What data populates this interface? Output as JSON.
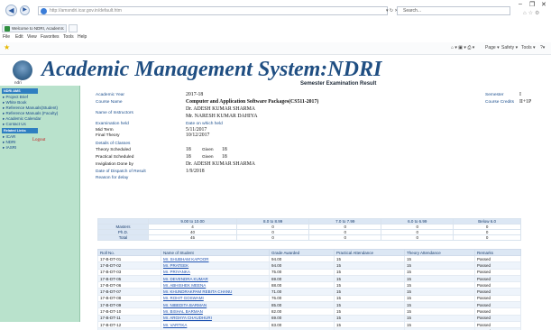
{
  "browser": {
    "address": "http://amsndri.icar.gov.in/default.htm",
    "search_placeholder": "Search...",
    "tab_title": "Welcome to NDRI, Academ...",
    "menu": [
      "File",
      "Edit",
      "View",
      "Favorites",
      "Tools",
      "Help"
    ],
    "commands": [
      "Page ▾",
      "Safety ▾",
      "Tools ▾"
    ]
  },
  "header": {
    "logo_text": "ndri",
    "title": "Academic Management System:NDRI",
    "subtitle": "Semester Examination Result"
  },
  "sidebar": {
    "section1": "NDRI AMS",
    "links1": [
      "Project Brief",
      "White Book",
      "Reference Manuals(Student)",
      "Reference Manuals (Faculty)",
      "Academic Calendar",
      "Contact Us"
    ],
    "section2": "Related Links",
    "links2": [
      "ICAR",
      "NDRI",
      "IASRI"
    ],
    "logout": "Logout"
  },
  "info": {
    "academic_year_label": "Academic Year",
    "academic_year": "2017-18",
    "course_name_label": "Course Name",
    "course_name": "Computer and Application Software Packages(CS511-2017)",
    "instructors_label": "Name of Instructors",
    "instructor1": "Dr.  ADESH KUMAR SHARMA",
    "instructor2": "Mr.  NARESH KUMAR DAHIYA",
    "exam_held_label": "Examination held",
    "date_held_label": "Date on which held",
    "mid_term_label": "Mid Term",
    "mid_term": "5/11/2017",
    "final_theory_label": "Final Theory",
    "final_theory": "10/12/2017",
    "classes_label": "Details of Classes",
    "theory_sched_label": "Theory Scheduled",
    "theory_sched": "18",
    "theory_given_label": "Given",
    "theory_given": "18",
    "practical_sched_label": "Practical Scheduled",
    "practical_sched": "18",
    "practical_given_label": "Given",
    "practical_given": "18",
    "invigilation_label": "Invigilation Done by",
    "invigilation": "Dr.  ADESH KUMAR SHARMA",
    "dispatch_label": "Date of Dispatch of Result",
    "dispatch": "1/9/2018",
    "delay_label": "Reason for delay",
    "semester_label": "Semester",
    "semester": "I",
    "credits_label": "Course Credits",
    "credits": "II+1P"
  },
  "distribution": {
    "headers": [
      "",
      "9.00 to 10.00",
      "8.0 to 8.99",
      "7.0 to 7.99",
      "6.0 to 6.99",
      "Below 6.0"
    ],
    "rows": [
      [
        "Masters",
        "4",
        "0",
        "0",
        "0",
        "0"
      ],
      [
        "Ph.D.",
        "40",
        "0",
        "0",
        "0",
        "0"
      ],
      [
        "Total",
        "45",
        "0",
        "0",
        "0",
        "0"
      ]
    ]
  },
  "students": {
    "headers": [
      "Roll No.",
      "Name of Student",
      "Grade Awarded",
      "Practical Attendance",
      "Theory Attendance",
      "Remarks"
    ],
    "rows": [
      [
        "17-B-DT-01",
        "Mr.  SHUBHAM     KAPOOR",
        "94.00",
        "15",
        "15",
        "Passed"
      ],
      [
        "17-B-DT-02",
        "Mr.  PRATEEK",
        "94.00",
        "15",
        "15",
        "Passed"
      ],
      [
        "17-B-DT-03",
        "Mr.  PRIYANKA",
        "75.00",
        "15",
        "15",
        "Passed"
      ],
      [
        "17-B-DT-05",
        "Mr.  DEVENDRA     KUMAR",
        "69.00",
        "15",
        "15",
        "Passed"
      ],
      [
        "17-B-DT-06",
        "Mr.  ABHISHEK     MEENA",
        "88.00",
        "15",
        "15",
        "Passed"
      ],
      [
        "17-B-DT-07",
        "Mr.  KHUNDRAKPAM     REBITA     CHANU",
        "71.00",
        "15",
        "15",
        "Passed"
      ],
      [
        "17-B-DT-08",
        "Mr.  ROHIT     GOSWAMI",
        "76.00",
        "15",
        "15",
        "Passed"
      ],
      [
        "17-B-DT-09",
        "Mr.  NIBEDITA     BARMAN",
        "85.00",
        "15",
        "15",
        "Passed"
      ],
      [
        "17-B-DT-10",
        "Mr.  BISHAL     BARMAN",
        "82.00",
        "15",
        "15",
        "Passed"
      ],
      [
        "17-B-DT-11",
        "Mr.  ARGHYA     CHAUDHURI",
        "69.00",
        "15",
        "15",
        "Passed"
      ],
      [
        "17-B-DT-12",
        "Mr.  VARTIKA",
        "83.00",
        "15",
        "15",
        "Passed"
      ],
      [
        "17-B-DT-13",
        "Mr.  HIMANSHU     VERMA",
        "71.00",
        "15",
        "15",
        "Passed"
      ]
    ]
  }
}
